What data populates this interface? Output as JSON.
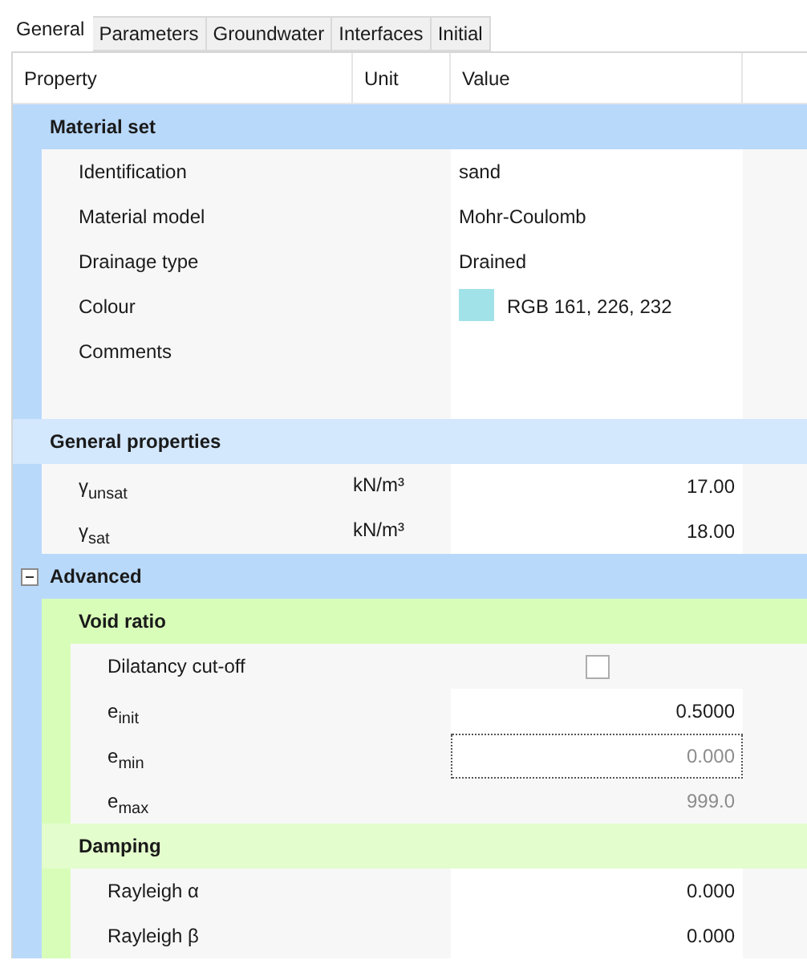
{
  "tabs": [
    {
      "label": "General",
      "selected": true
    },
    {
      "label": "Parameters",
      "selected": false
    },
    {
      "label": "Groundwater",
      "selected": false
    },
    {
      "label": "Interfaces",
      "selected": false
    },
    {
      "label": "Initial",
      "selected": false
    }
  ],
  "table": {
    "columns": [
      "Property",
      "Unit",
      "Value"
    ],
    "groups": [
      {
        "title": "Material set",
        "rows": [
          {
            "kind": "text",
            "label": "Identification",
            "value": "sand",
            "disabled": false,
            "focused": false
          },
          {
            "kind": "text",
            "label": "Material model",
            "value": "Mohr-Coulomb",
            "disabled": false,
            "focused": false
          },
          {
            "kind": "text",
            "label": "Drainage type",
            "value": "Drained",
            "disabled": false,
            "focused": false
          },
          {
            "kind": "color",
            "label": "Colour",
            "value": "RGB 161, 226, 232",
            "color": "#a1e2e8",
            "disabled": false,
            "focused": false
          },
          {
            "kind": "multiline",
            "label": "Comments",
            "focused": false
          }
        ]
      },
      {
        "title": "General properties",
        "rows": [
          {
            "kind": "number",
            "label": "γ$_{unsat}$",
            "unit": "kN/m³",
            "value": "17.00",
            "disabled": false,
            "focused": false
          },
          {
            "kind": "number",
            "label": "γ$_{sat}$",
            "unit": "kN/m³",
            "value": "18.00",
            "disabled": false,
            "focused": false
          }
        ]
      },
      {
        "title": "Advanced",
        "expanded": true,
        "children": [
          {
            "title": "Void ratio",
            "rows": [
              {
                "kind": "check",
                "label": "Dilatancy cut-off",
                "checked": false,
                "focused": false
              },
              {
                "kind": "number",
                "label": "e$_{init}$",
                "value": "0.5000",
                "disabled": false,
                "focused": false
              },
              {
                "kind": "number",
                "label": "e$_{min}$",
                "value": "0.000",
                "disabled": true,
                "focused": true
              },
              {
                "kind": "number",
                "label": "e$_{max}$",
                "value": "999.0",
                "disabled": true,
                "focused": false
              }
            ]
          },
          {
            "title": "Damping",
            "rows": [
              {
                "kind": "number",
                "label": "Rayleigh α",
                "value": "0.000",
                "disabled": false,
                "focused": false
              },
              {
                "kind": "number",
                "label": "Rayleigh β",
                "value": "0.000",
                "disabled": false,
                "focused": false
              }
            ]
          }
        ]
      }
    ]
  }
}
